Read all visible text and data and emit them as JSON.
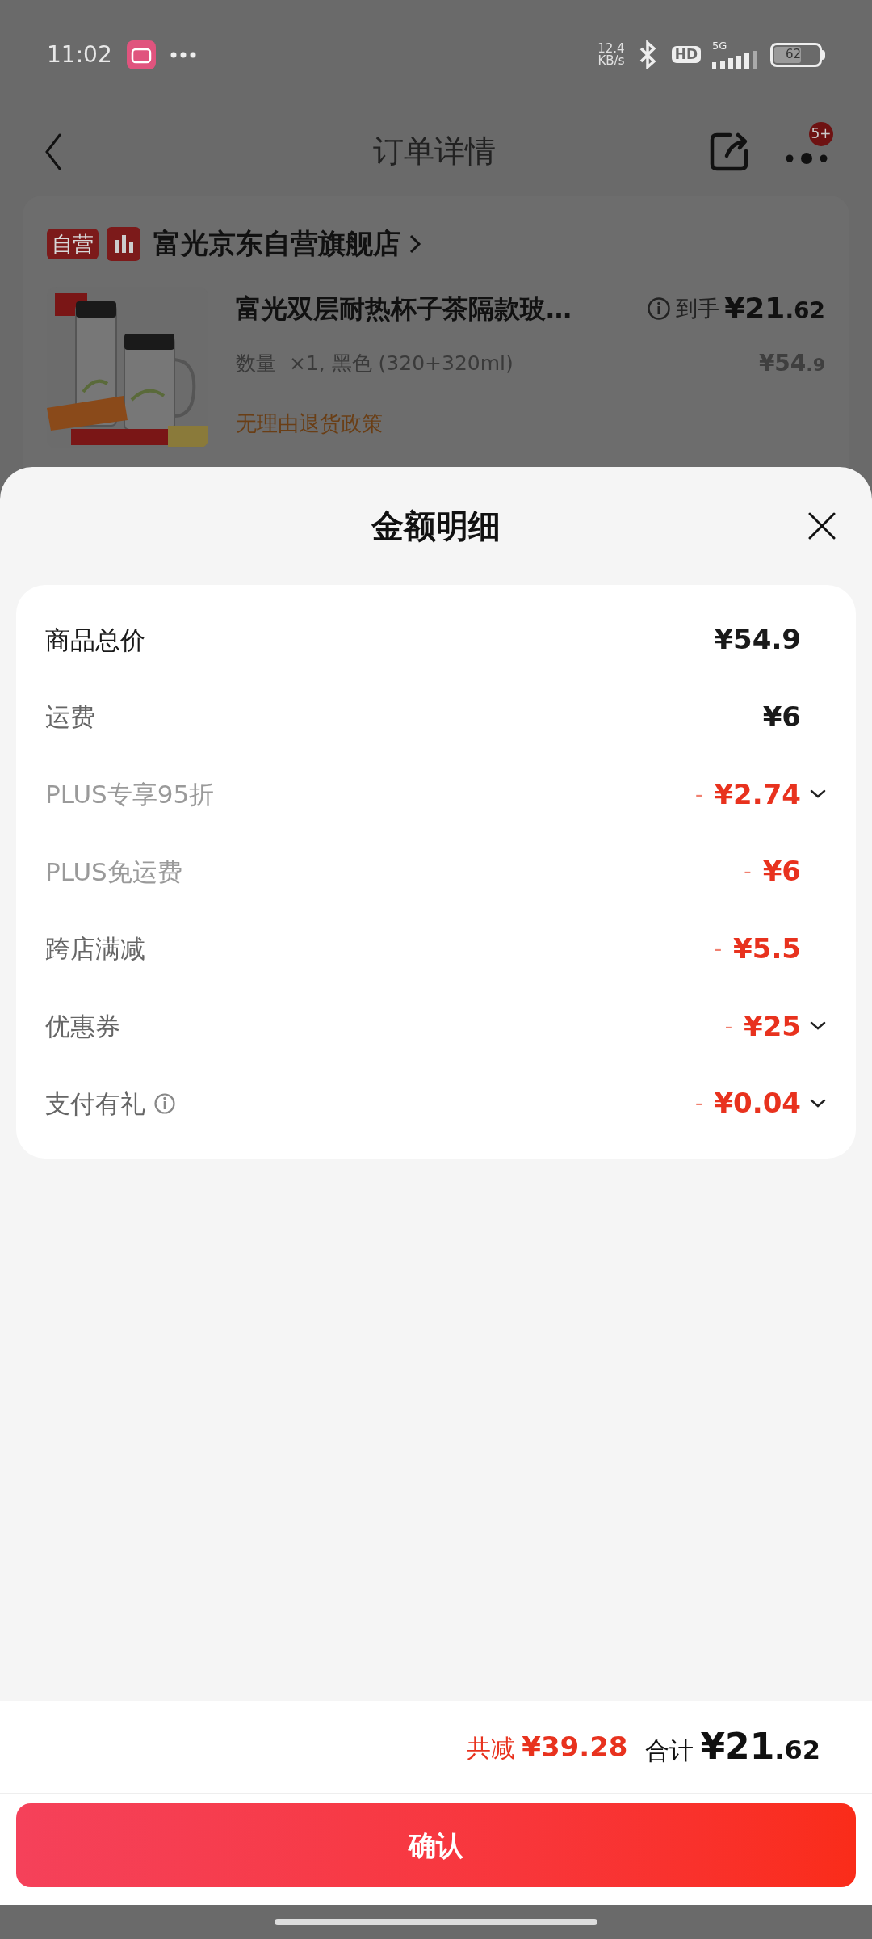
{
  "status_bar": {
    "time": "11:02",
    "speed_value": "12.4",
    "speed_unit": "KB/s",
    "hd": "HD",
    "network": "5G",
    "battery": "62"
  },
  "nav": {
    "title": "订单详情",
    "badge": "5+"
  },
  "store": {
    "tag": "自营",
    "name": "富光京东自营旗舰店",
    "product": {
      "title": "富光双层耐热杯子茶隔款玻…",
      "spec": "数量  ×1, 黑色 (320+320ml)",
      "policy": "无理由退货政策",
      "net_label": "到手",
      "net_price": "¥21.62",
      "original_price": "¥54.9"
    }
  },
  "sheet": {
    "title": "金额明细",
    "rows": [
      {
        "label": "商品总价",
        "primary": true,
        "muted": false,
        "kind": "charge",
        "amount": "¥54.9",
        "expandable": false,
        "info": false
      },
      {
        "label": "运费",
        "primary": false,
        "muted": false,
        "kind": "charge",
        "amount": "¥6",
        "expandable": false,
        "info": false
      },
      {
        "label": "PLUS专享95折",
        "primary": false,
        "muted": true,
        "kind": "discount",
        "sign": "-",
        "amount": "¥2.74",
        "expandable": true,
        "info": false
      },
      {
        "label": "PLUS免运费",
        "primary": false,
        "muted": true,
        "kind": "discount",
        "sign": "-",
        "amount": "¥6",
        "expandable": false,
        "info": false
      },
      {
        "label": "跨店满减",
        "primary": false,
        "muted": false,
        "kind": "discount",
        "sign": "-",
        "amount": "¥5.5",
        "expandable": false,
        "info": false
      },
      {
        "label": "优惠券",
        "primary": false,
        "muted": false,
        "kind": "discount",
        "sign": "-",
        "amount": "¥25",
        "expandable": true,
        "info": false
      },
      {
        "label": "支付有礼",
        "primary": false,
        "muted": false,
        "kind": "discount",
        "sign": "-",
        "amount": "¥0.04",
        "expandable": true,
        "info": true
      }
    ]
  },
  "footer": {
    "saved_label": "共减",
    "saved_amount": "¥39.28",
    "total_label": "合计",
    "total_amount": "¥21.62",
    "confirm": "确认"
  }
}
